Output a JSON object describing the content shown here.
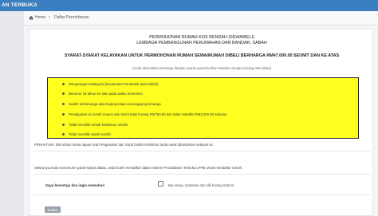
{
  "app": {
    "brand": "AN TERBUKA"
  },
  "breadcrumb": {
    "home": "Home",
    "separator": ">",
    "current": "Daftar Permohonan"
  },
  "form": {
    "title_line1": "PERMOHONAN RUMAH KOS RENDAH (SEWA/BELI)",
    "title_line2": "LEMBAGA PEMBANGUNAN PERUMAHAN DAN BANDAR, SABAH",
    "title_line3": "SYARAT-SYARAT KELAYAKAN UNTUK PERMOHONAN RUMAH SEWA/RUMAH DIBELI BERHARGA RM47,000.00 SEUNIT DAN KE ATAS",
    "note": "(Anda disarankan bersetuju dengan syarat-syarat berikut sebelum mengisi borang atas talian)",
    "requirements": [
      "Warganegara Malaysia (keutamaan Penduduk asal Sabah)",
      "Berumur 18 tahun ke atas pada waktu memohon",
      "Sudah berkeluarga atau bujang tetapi menanggung keluarga",
      "Pendapatan isi rumah (suami dan isteri) tidak kurang RM750.00 dan tidak melebihi RM3,000.00 sebulan",
      "Tidak memiliki rumah kediaman sendiri",
      "Tidak memiliki tanah sendiri"
    ],
    "warning": "PERHATIAN: Sila imbas muka depan Kad Pengenalan dan Surat Daftar Kelahiran anda untuk dilampirkan selepas ini.",
    "terms_notice": "Sekiranya anda memenuhi syarat-syarat diatas, anda boleh mendaftar dalam Sistem Pendaftaran Terbuka LPPB untuk mendaftar rumah.",
    "agree_label": "Saya bersetuju dan ingin memohon",
    "agree_help": "Jika setuju, tandakan dan klik butang Submit.",
    "submit_label": "Submit"
  },
  "colors": {
    "topbar": "#3a7fc0",
    "highlight": "#ffff1f",
    "submit_disabled": "#9aa3ad"
  }
}
